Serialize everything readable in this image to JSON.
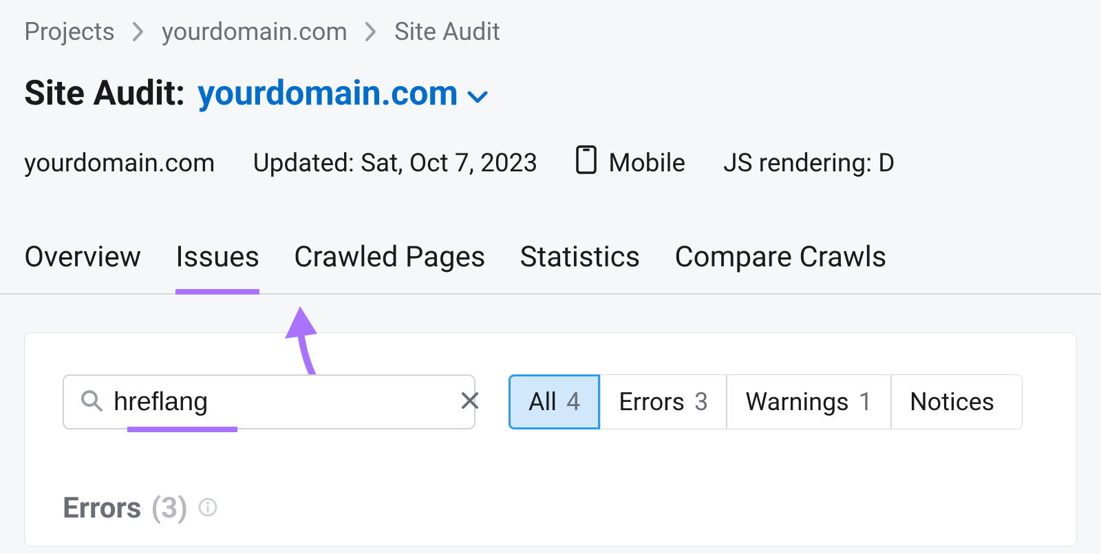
{
  "breadcrumb": {
    "items": [
      "Projects",
      "yourdomain.com",
      "Site Audit"
    ]
  },
  "title": {
    "prefix": "Site Audit:",
    "domain": "yourdomain.com"
  },
  "meta": {
    "domain": "yourdomain.com",
    "updated": "Updated: Sat, Oct 7, 2023",
    "device": "Mobile",
    "js_rendering_label": "JS rendering: D"
  },
  "tabs": [
    "Overview",
    "Issues",
    "Crawled Pages",
    "Statistics",
    "Compare Crawls"
  ],
  "search": {
    "value": "hreflang"
  },
  "filters": [
    {
      "label": "All",
      "count": "4",
      "selected": true
    },
    {
      "label": "Errors",
      "count": "3",
      "selected": false
    },
    {
      "label": "Warnings",
      "count": "1",
      "selected": false
    },
    {
      "label": "Notices",
      "count": "",
      "selected": false
    }
  ],
  "section": {
    "label": "Errors",
    "count": "(3)"
  },
  "colors": {
    "accent_purple": "#a972ff",
    "link_blue": "#006dca",
    "pill_selected_bg": "#cfe8fb",
    "pill_selected_border": "#2f9bed"
  }
}
